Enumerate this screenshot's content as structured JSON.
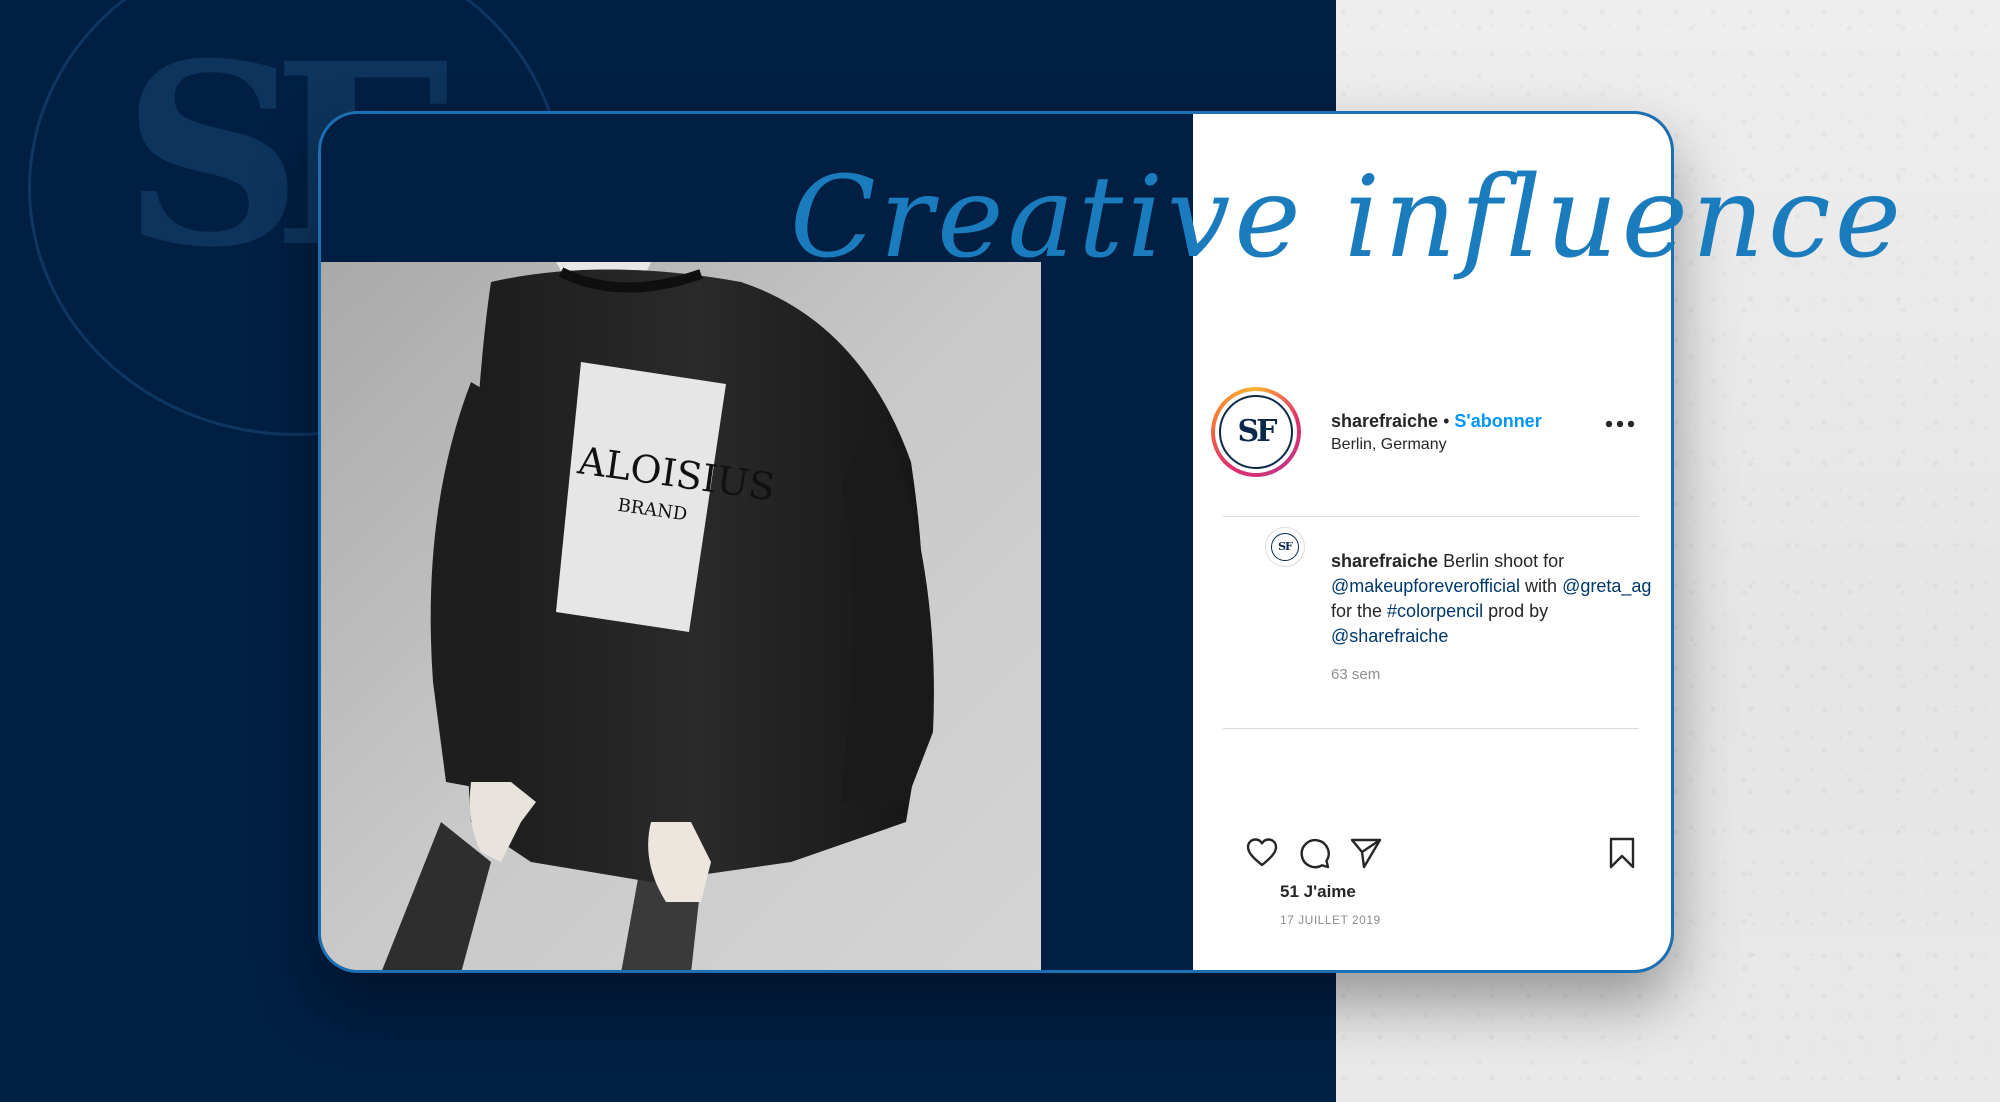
{
  "colors": {
    "navy_background": "#011f42",
    "accent_blue": "#1a7cbd",
    "card_border": "#1b6fb4",
    "follow_blue": "#0095f6",
    "link_blue": "#00376b",
    "concrete": "#e8e8e8"
  },
  "watermark": {
    "monogram": "SF"
  },
  "headline": {
    "text": "Creative influence"
  },
  "photo": {
    "shirt_brand": "ALOISIUS",
    "shirt_subtitle": "BRAND"
  },
  "post": {
    "avatar_monogram": "SF",
    "username": "sharefraiche",
    "separator": "•",
    "follow_label": "S'abonner",
    "location": "Berlin, Germany",
    "more_icon": "more-horizontal-icon",
    "caption": {
      "username": "sharefraiche",
      "text_1": "Berlin shoot for",
      "mention_1": "@makeupforeverofficial",
      "text_2": "with",
      "mention_2": "@greta_ag",
      "text_3": "for the",
      "hashtag": "#colorpencil",
      "text_4": "prod by",
      "mention_3": "@sharefraiche",
      "time_ago": "63 sem"
    },
    "actions": {
      "like_icon": "heart-icon",
      "comment_icon": "comment-icon",
      "share_icon": "send-icon",
      "save_icon": "bookmark-icon"
    },
    "likes": "51 J'aime",
    "date": "17 JUILLET 2019"
  }
}
